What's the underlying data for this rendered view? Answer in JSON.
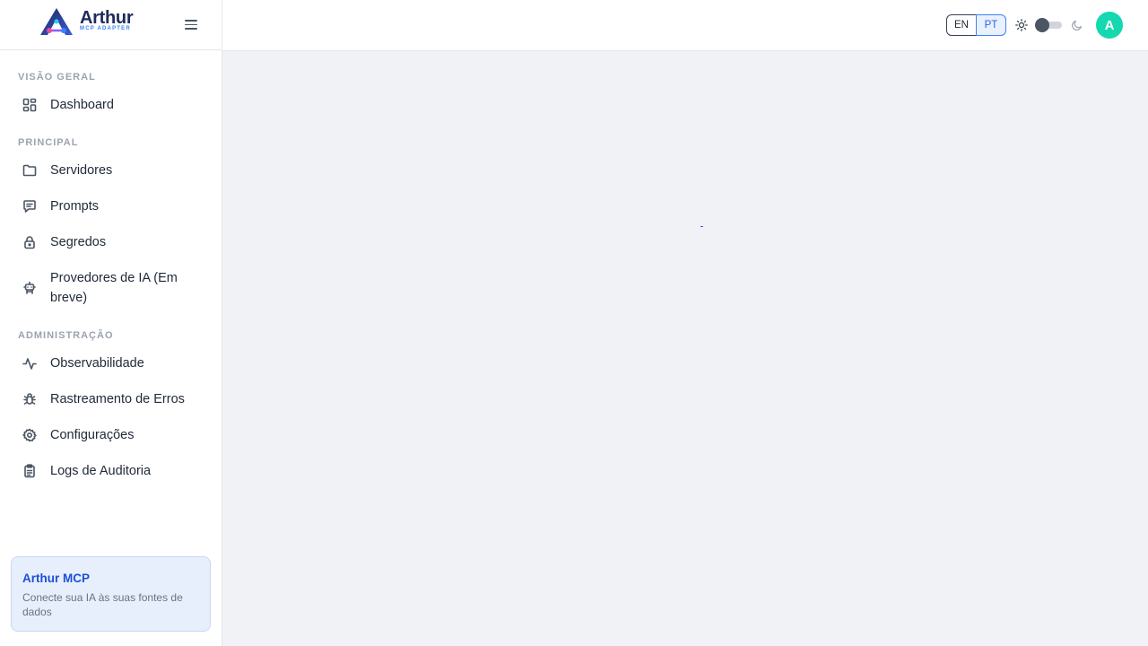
{
  "brand": {
    "name": "Arthur",
    "subtitle": "MCP ADAPTER"
  },
  "sidebar": {
    "sections": [
      {
        "title": "VISÃO GERAL"
      },
      {
        "title": "PRINCIPAL"
      },
      {
        "title": "ADMINISTRAÇÃO"
      }
    ],
    "items": [
      {
        "label": "Dashboard",
        "icon": "dashboard-icon"
      },
      {
        "label": "Servidores",
        "icon": "folder-icon"
      },
      {
        "label": "Prompts",
        "icon": "message-icon"
      },
      {
        "label": "Segredos",
        "icon": "lock-icon"
      },
      {
        "label": "Provedores de IA (Em breve)",
        "icon": "robot-icon"
      },
      {
        "label": "Observabilidade",
        "icon": "activity-icon"
      },
      {
        "label": "Rastreamento de Erros",
        "icon": "bug-icon"
      },
      {
        "label": "Configurações",
        "icon": "gear-icon"
      },
      {
        "label": "Logs de Auditoria",
        "icon": "clipboard-icon"
      }
    ],
    "card": {
      "title": "Arthur MCP",
      "text": "Conecte sua IA às suas fontes de dados"
    }
  },
  "header": {
    "languages": [
      "EN",
      "PT"
    ],
    "selected_language": "PT",
    "theme": "light",
    "avatar_initial": "A"
  },
  "colors": {
    "accent": "#2563eb",
    "avatar": "#14d8b0",
    "card_bg": "#e8effc"
  }
}
